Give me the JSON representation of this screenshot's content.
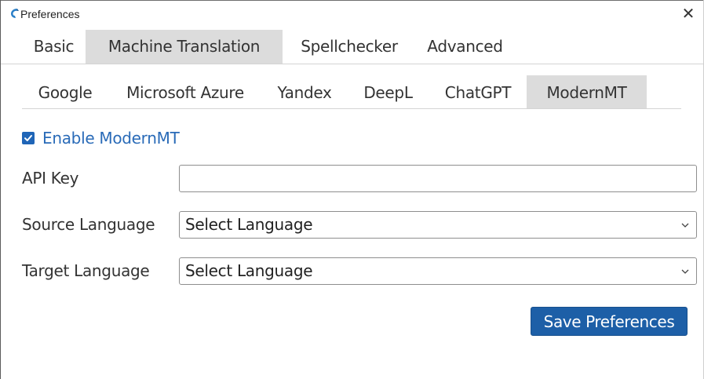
{
  "window": {
    "title": "Preferences",
    "close_glyph": "✕"
  },
  "main_tabs": [
    {
      "label": "Basic",
      "active": false
    },
    {
      "label": "Machine Translation",
      "active": true
    },
    {
      "label": "Spellchecker",
      "active": false
    },
    {
      "label": "Advanced",
      "active": false
    }
  ],
  "sub_tabs": [
    {
      "label": "Google",
      "active": false
    },
    {
      "label": "Microsoft Azure",
      "active": false
    },
    {
      "label": "Yandex",
      "active": false
    },
    {
      "label": "DeepL",
      "active": false
    },
    {
      "label": "ChatGPT",
      "active": false
    },
    {
      "label": "ModernMT",
      "active": true
    }
  ],
  "enable": {
    "label": "Enable ModernMT",
    "checked": true
  },
  "fields": {
    "api_key": {
      "label": "API Key",
      "value": ""
    },
    "source_language": {
      "label": "Source Language",
      "value": "Select Language"
    },
    "target_language": {
      "label": "Target Language",
      "value": "Select Language"
    }
  },
  "actions": {
    "save_label": "Save Preferences"
  },
  "colors": {
    "accent": "#1d5fa7",
    "link": "#2a6bb8",
    "active_tab": "#dcdcdc"
  },
  "icons": {
    "app": "app-logo-icon",
    "close": "close-icon",
    "check": "checkmark-icon",
    "dropdown": "chevron-down-icon"
  }
}
